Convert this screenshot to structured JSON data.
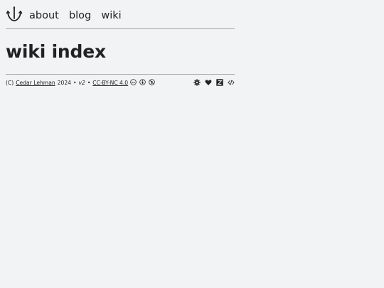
{
  "nav": {
    "logo_icon": "anchor-hook-logo-icon",
    "links": [
      "about",
      "blog",
      "wiki"
    ]
  },
  "main": {
    "title": "wiki index"
  },
  "footer": {
    "copyright": "(C)",
    "author": "Cedar Lehman",
    "year": "2024",
    "sep1": "•",
    "version": "v2",
    "sep2": "•",
    "license": "CC-BY-NC 4.0",
    "license_icons": [
      "cc-icon",
      "by-icon",
      "nc-icon"
    ],
    "right_icons": [
      "gear-icon",
      "heart-icon",
      "zotero-icon",
      "code-icon"
    ]
  }
}
